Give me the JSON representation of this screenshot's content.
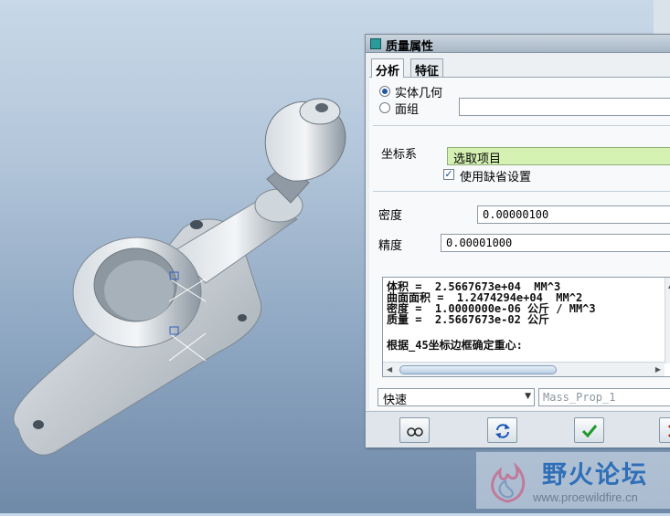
{
  "dialog": {
    "title": "质量属性",
    "tabs": [
      {
        "label": "分析",
        "active": true
      },
      {
        "label": "特征",
        "active": false
      }
    ],
    "geometry_options": [
      {
        "label": "实体几何",
        "selected": true
      },
      {
        "label": "面组",
        "selected": false
      }
    ],
    "quilt_field_value": "",
    "coord_system_label": "坐标系",
    "select_items_label": "选取项目",
    "use_default_label": "使用缺省设置",
    "use_default_checked": true,
    "density_label": "密度",
    "density_value": "0.00000100",
    "accuracy_label": "精度",
    "accuracy_value": "0.00001000",
    "results": [
      "体积 =  2.5667673e+04  MM^3",
      "曲面面积 =  1.2474294e+04  MM^2",
      "密度 =  1.0000000e-06 公斤 / MM^3",
      "质量 =  2.5667673e-02 公斤",
      "",
      "根据_45坐标边框确定重心:"
    ],
    "mode_value": "快速",
    "name_placeholder": "Mass_Prop_1",
    "buttons": {
      "preview": "glasses-icon",
      "repeat": "refresh-icon",
      "ok": "checkmark-icon",
      "cancel": "close-icon"
    }
  },
  "watermark": {
    "title": "野火论坛",
    "url": "www.proewildfire.cn"
  },
  "colors": {
    "select_highlight": "#d6f2b3",
    "ok_green": "#1e9a2a",
    "cancel_red": "#c62828"
  }
}
